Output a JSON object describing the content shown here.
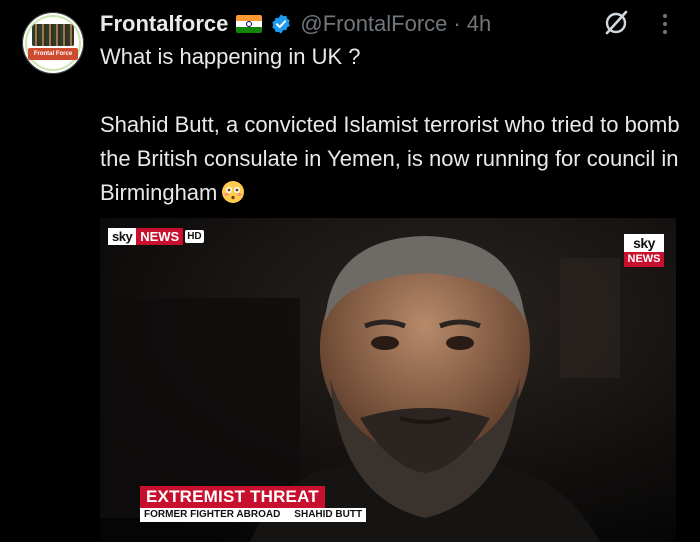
{
  "author": {
    "name": "Frontalforce",
    "handle": "@FrontalForce",
    "separator": "·",
    "time": "4h",
    "avatar_caption": "Frontal Force",
    "flag_icon": "india-flag-icon",
    "verified_color": "#1d9bf0"
  },
  "post": {
    "line1": "What is happening in UK ?",
    "paragraph": "Shahid Butt, a convicted Islamist terrorist who tried to bomb the British consulate in Yemen, is now running for council in Birmingham",
    "emoji_icon": "flushed-face-emoji"
  },
  "media": {
    "sky_logo": "sky",
    "news_logo": "NEWS",
    "hd_logo": "HD",
    "headline": "EXTREMIST THREAT",
    "strap_left": "FORMER FIGHTER ABROAD",
    "strap_right": "SHAHID BUTT",
    "accent": "#c8102e"
  },
  "actions": {
    "grok_icon": "grok-icon",
    "more_icon": "more-vertical-icon"
  }
}
